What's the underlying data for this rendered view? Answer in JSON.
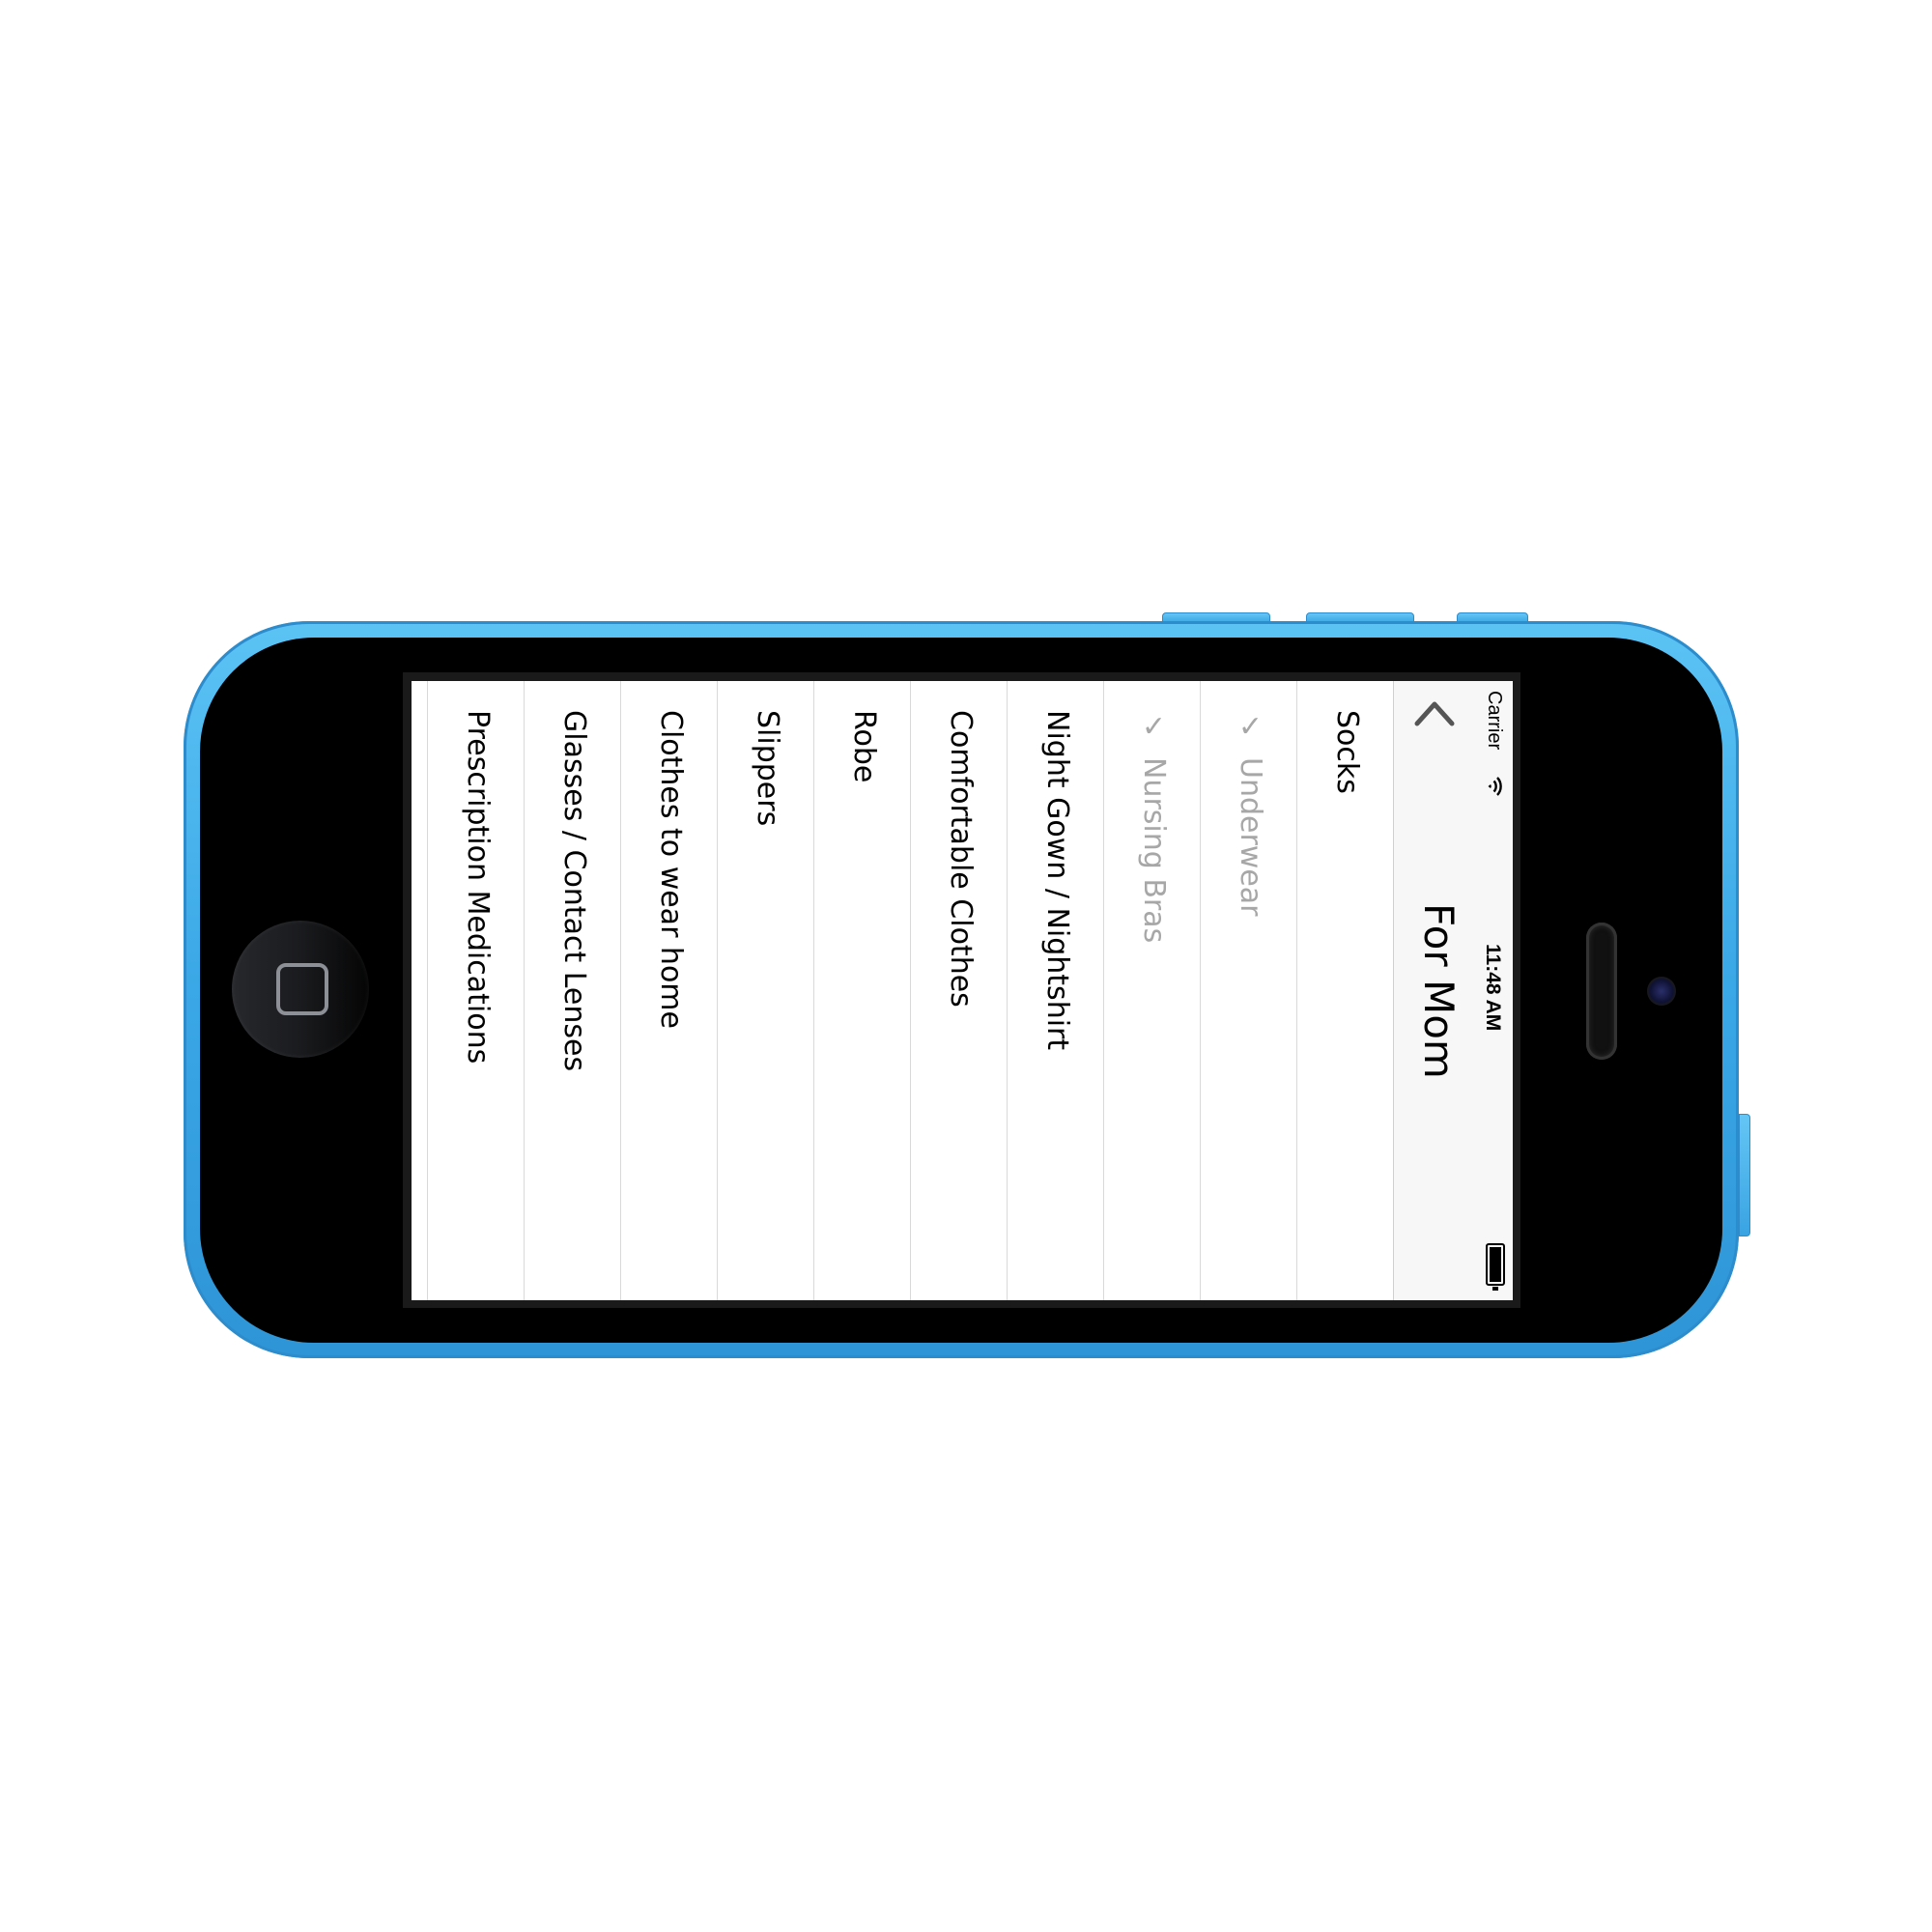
{
  "status_bar": {
    "carrier": "Carrier",
    "time": "11:48 AM",
    "wifi_icon": "wifi-icon",
    "battery_icon": "battery-icon"
  },
  "nav": {
    "back_icon": "chevron-back-icon",
    "title": "For Mom"
  },
  "list": {
    "check_glyph": "✓",
    "items": [
      {
        "label": "Socks",
        "checked": false
      },
      {
        "label": "Underwear",
        "checked": true
      },
      {
        "label": "Nursing Bras",
        "checked": true
      },
      {
        "label": "Night Gown / Nightshirt",
        "checked": false
      },
      {
        "label": "Comfortable Clothes",
        "checked": false
      },
      {
        "label": "Robe",
        "checked": false
      },
      {
        "label": "Slippers",
        "checked": false
      },
      {
        "label": "Clothes to wear home",
        "checked": false
      },
      {
        "label": "Glasses / Contact Lenses",
        "checked": false
      },
      {
        "label": "Prescription Medications",
        "checked": false
      }
    ]
  },
  "colors": {
    "phone_body": "#3aa7e6",
    "checked_text": "#a7a7a7",
    "nav_background": "#f7f7f7"
  }
}
